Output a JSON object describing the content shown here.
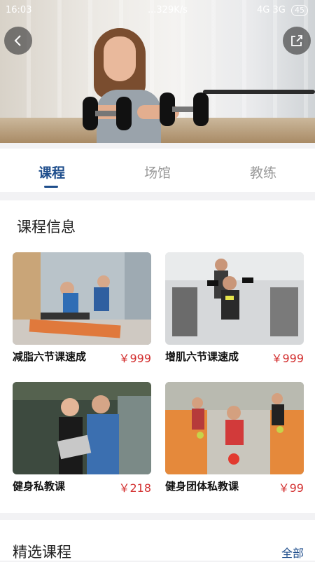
{
  "status_bar": {
    "time": "16:03",
    "network_speed": "...329K/s",
    "signal_text": "4G 3G",
    "battery": "45"
  },
  "hero": {
    "icons": {
      "back": "back-icon",
      "share": "share-icon"
    }
  },
  "tabs": {
    "items": [
      {
        "label": "课程",
        "active": true
      },
      {
        "label": "场馆",
        "active": false
      },
      {
        "label": "教练",
        "active": false
      }
    ],
    "accent_color": "#1f4e8c"
  },
  "course_info": {
    "title": "课程信息",
    "courses": [
      {
        "name": "减脂六节课速成",
        "price": "￥999"
      },
      {
        "name": "增肌六节课速成",
        "price": "￥999"
      },
      {
        "name": "健身私教课",
        "price": "￥218"
      },
      {
        "name": "健身团体私教课",
        "price": "￥99"
      }
    ],
    "price_color": "#d33030"
  },
  "featured": {
    "title": "精选课程",
    "more_label": "全部"
  }
}
